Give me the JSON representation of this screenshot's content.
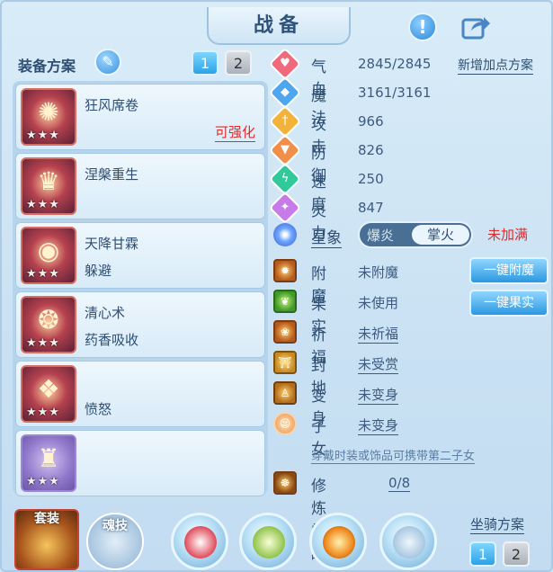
{
  "header": {
    "title": "战备"
  },
  "equip_plan": {
    "label": "装备方案",
    "buttons": [
      "1",
      "2"
    ]
  },
  "equipment": [
    {
      "name": "狂风席卷",
      "sub": "",
      "tag": "可强化",
      "stars": "★★★"
    },
    {
      "name": "涅槃重生",
      "sub": "",
      "tag": "",
      "stars": "★★★"
    },
    {
      "name": "天降甘霖",
      "sub": "躲避",
      "tag": "",
      "stars": "★★★"
    },
    {
      "name": "清心术",
      "sub": "药香吸收",
      "tag": "",
      "stars": "★★★"
    },
    {
      "name": "",
      "sub": "愤怒",
      "tag": "",
      "stars": "★★★"
    },
    {
      "name": "",
      "sub": "",
      "tag": "",
      "stars": "★★★"
    }
  ],
  "stats": [
    {
      "name": "气血",
      "value": "2845/2845",
      "icon": "heart-icon",
      "color": "#f06a7e"
    },
    {
      "name": "魔法",
      "value": "3161/3161",
      "icon": "shield-icon",
      "color": "#4ea6f0"
    },
    {
      "name": "攻击",
      "value": "966",
      "icon": "sword-icon",
      "color": "#f3b23a"
    },
    {
      "name": "防御",
      "value": "826",
      "icon": "armor-icon",
      "color": "#f08f4a"
    },
    {
      "name": "速度",
      "value": "250",
      "icon": "bolt-icon",
      "color": "#2fc99a"
    },
    {
      "name": "灵力",
      "value": "847",
      "icon": "sparkle-icon",
      "color": "#c77be8"
    }
  ],
  "new_plan_label": "新增加点方案",
  "constellation": {
    "name": "星象",
    "options": [
      "爆炎",
      "掌火"
    ],
    "status": "未加满"
  },
  "bonus": [
    {
      "name": "附魔",
      "value": "未附魔",
      "link": false
    },
    {
      "name": "果实",
      "value": "未使用",
      "link": false
    },
    {
      "name": "祈福",
      "value": "未祈福",
      "link": true
    },
    {
      "name": "封地",
      "value": "未受赏",
      "link": true
    },
    {
      "name": "变身",
      "value": "未变身",
      "link": true
    },
    {
      "name": "子女",
      "value": "未变身",
      "link": true
    }
  ],
  "actions": {
    "enchant": "一键附魔",
    "fruit": "一键果实"
  },
  "hint": "穿戴时装或饰品可携带第二子女",
  "cultivation": {
    "name": "修炼觉醒",
    "value": "0/8"
  },
  "bottom": {
    "suit_label": "套装",
    "soul_label": "魂技"
  },
  "mount_plan": {
    "label": "坐骑方案",
    "buttons": [
      "1",
      "2"
    ]
  }
}
